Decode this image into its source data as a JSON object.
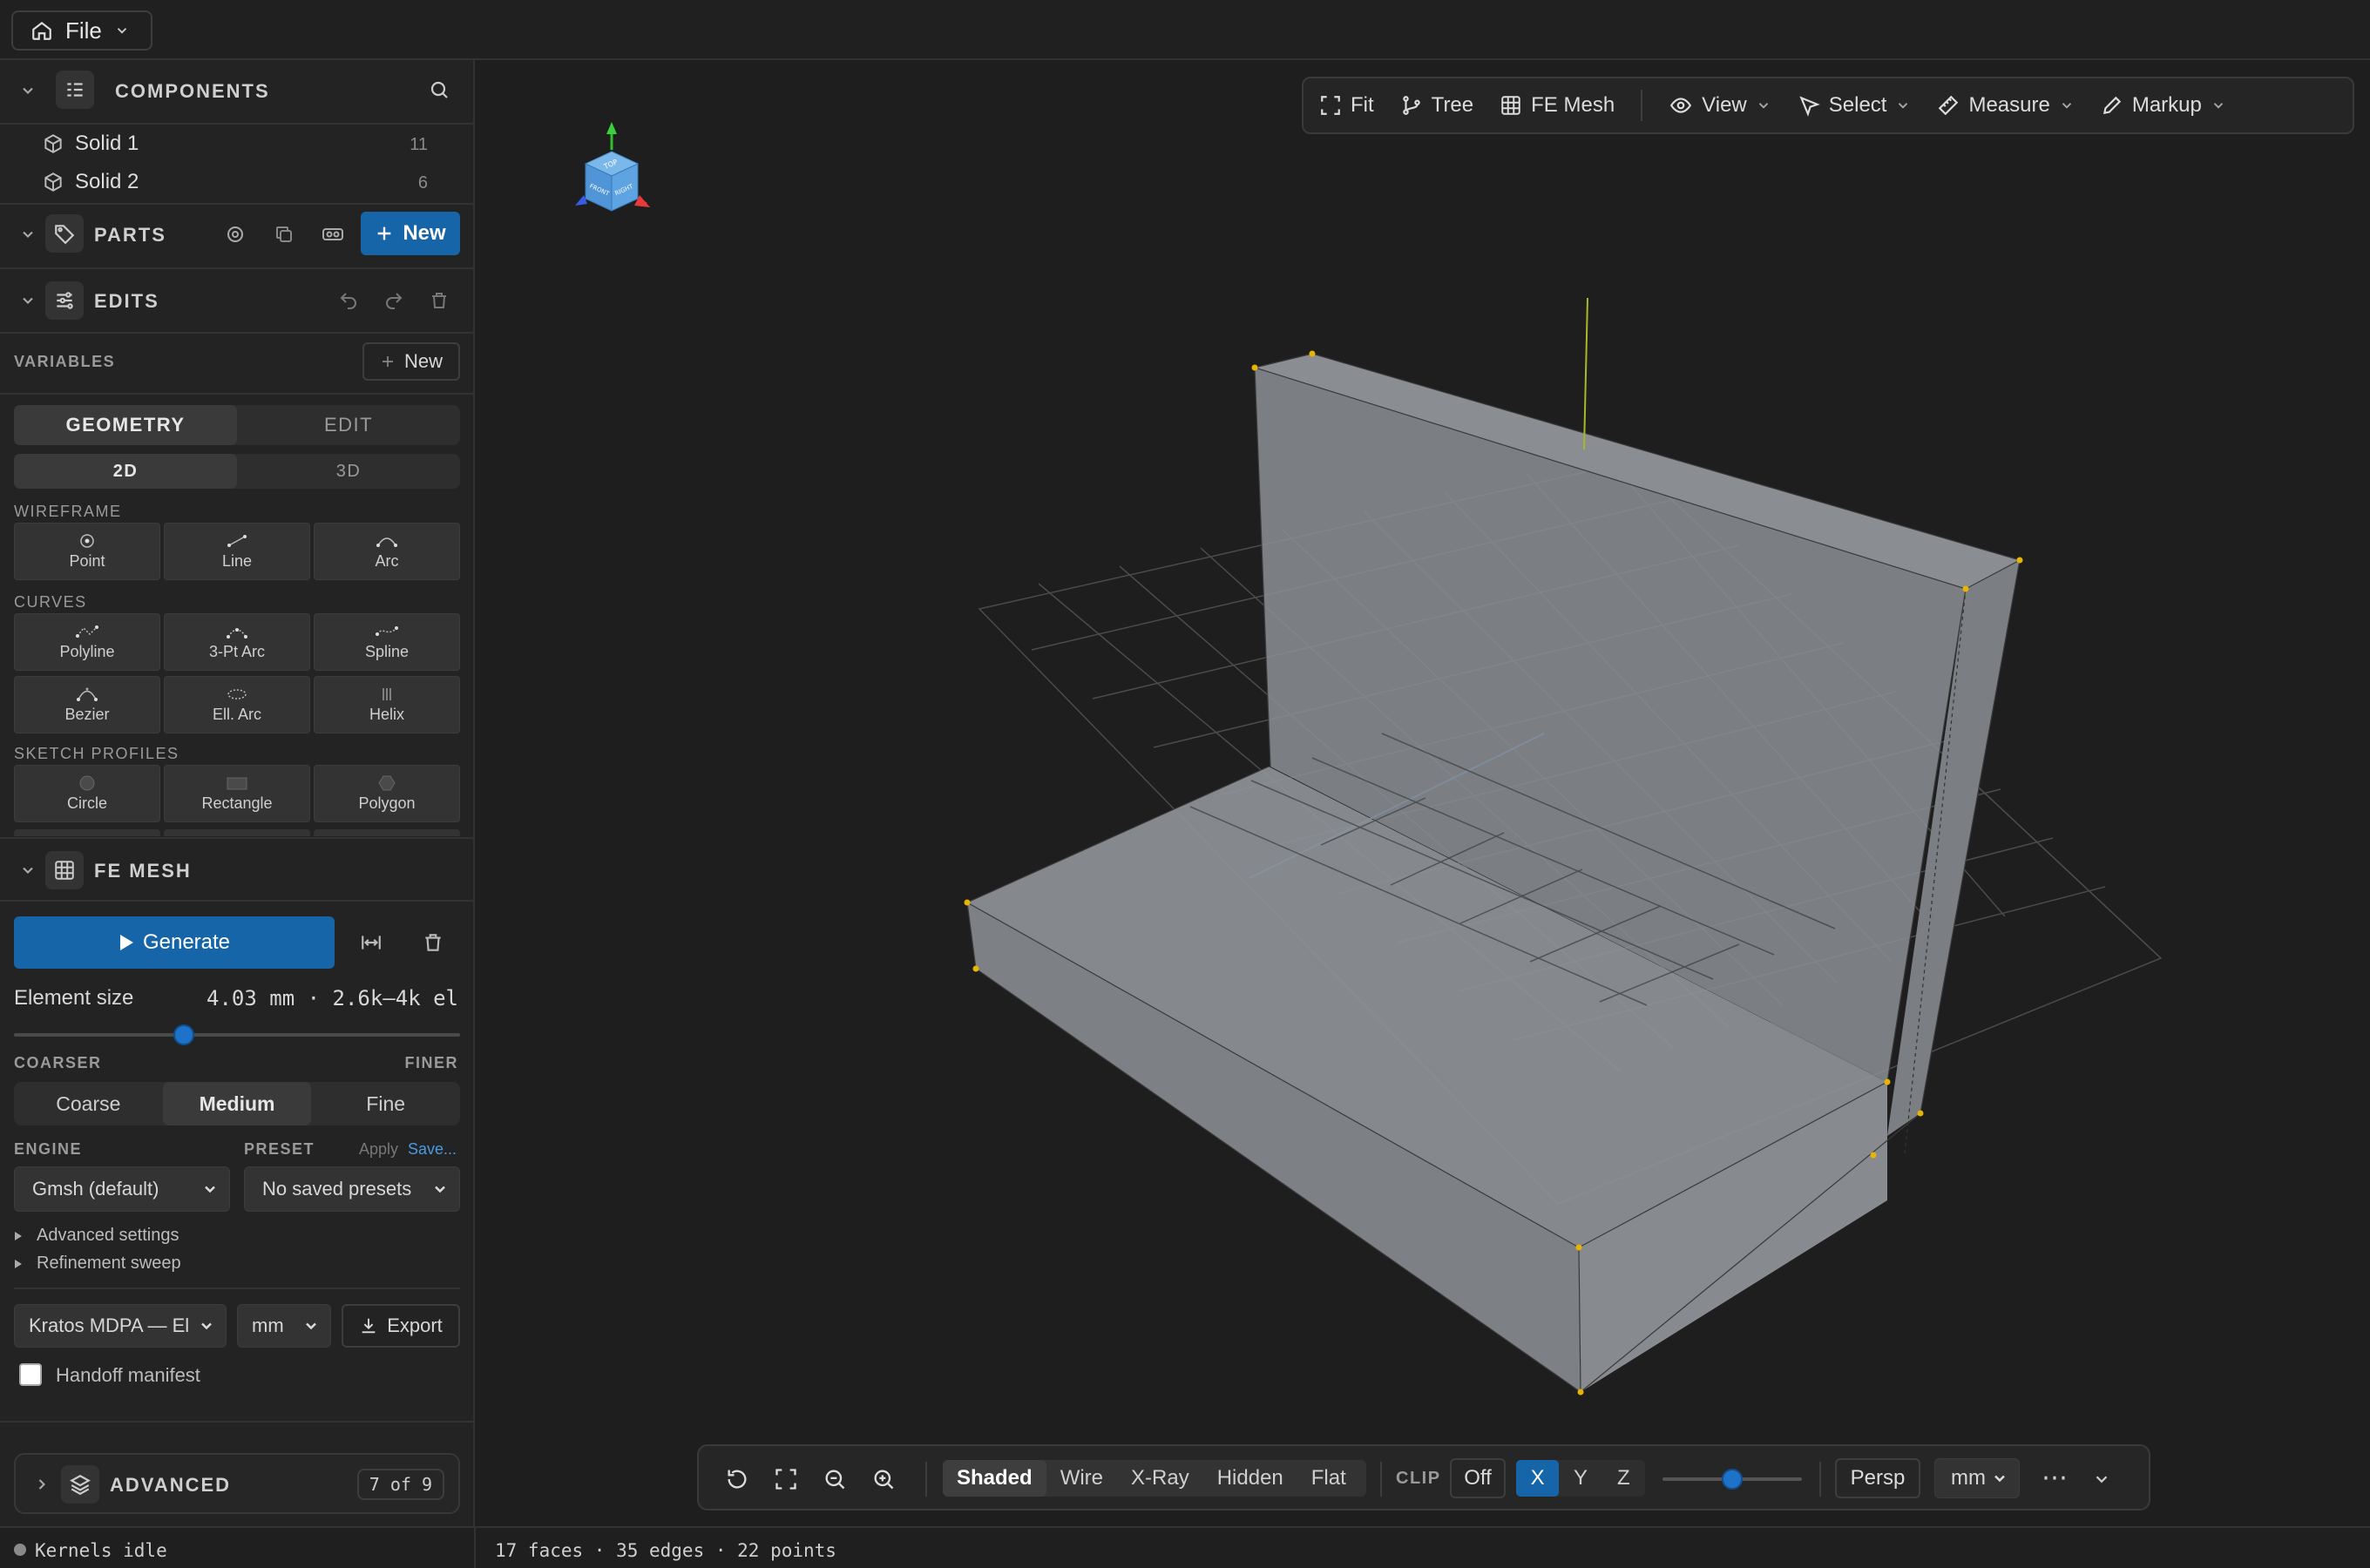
{
  "top": {
    "file_label": "File"
  },
  "components": {
    "title": "COMPONENTS",
    "items": [
      {
        "label": "Solid 1",
        "count": "11"
      },
      {
        "label": "Solid 2",
        "count": "6"
      }
    ]
  },
  "parts": {
    "title": "PARTS",
    "new_label": "New"
  },
  "edits": {
    "title": "EDITS",
    "variables_label": "VARIABLES",
    "variables_new": "New",
    "mode_tabs": [
      "GEOMETRY",
      "EDIT"
    ],
    "dim_tabs": [
      "2D",
      "3D"
    ],
    "wireframe_label": "WIREFRAME",
    "wireframe_tools": [
      "Point",
      "Line",
      "Arc"
    ],
    "curves_label": "CURVES",
    "curve_tools": [
      "Polyline",
      "3-Pt Arc",
      "Spline",
      "Bezier",
      "Ell. Arc",
      "Helix"
    ],
    "profiles_label": "SKETCH PROFILES",
    "profile_tools": [
      "Circle",
      "Rectangle",
      "Polygon"
    ]
  },
  "fe_mesh": {
    "title": "FE MESH",
    "generate_label": "Generate",
    "element_size_label": "Element size",
    "element_size_value": "4.03 mm · 2.6k–4k el",
    "slider_fraction": 0.38,
    "coarser_label": "COARSER",
    "finer_label": "FINER",
    "density_options": [
      "Coarse",
      "Medium",
      "Fine"
    ],
    "density_selected": "Medium",
    "engine_label": "ENGINE",
    "engine_value": "Gmsh (default)",
    "preset_label": "PRESET",
    "preset_apply": "Apply",
    "preset_save": "Save...",
    "preset_value": "No saved presets",
    "advanced_settings": "Advanced settings",
    "refinement_sweep": "Refinement sweep",
    "export_format": "Kratos MDPA — El",
    "export_unit": "mm",
    "export_label": "Export",
    "handoff_label": "Handoff manifest"
  },
  "advanced": {
    "title": "ADVANCED",
    "badge": "7 of 9"
  },
  "status": {
    "kernels": "Kernels idle",
    "stats": "17 faces · 35 edges · 22 points"
  },
  "view_toolbar": {
    "fit": "Fit",
    "tree": "Tree",
    "fe_mesh": "FE Mesh",
    "view": "View",
    "select": "Select",
    "measure": "Measure",
    "markup": "Markup"
  },
  "render_toolbar": {
    "modes": [
      "Shaded",
      "Wire",
      "X-Ray",
      "Hidden",
      "Flat"
    ],
    "mode_selected": "Shaded",
    "clip_label": "CLIP",
    "clip_off": "Off",
    "axes": [
      "X",
      "Y",
      "Z"
    ],
    "axis_selected": "X",
    "clip_slider_fraction": 0.5,
    "projection": "Persp",
    "unit": "mm",
    "more": "⋯"
  },
  "viewcube": {
    "top": "TOP",
    "front": "FRONT",
    "right": "RIGHT"
  },
  "colors": {
    "accent": "#1565a8",
    "face": "#8a8d92",
    "background": "#1e1e1e"
  }
}
